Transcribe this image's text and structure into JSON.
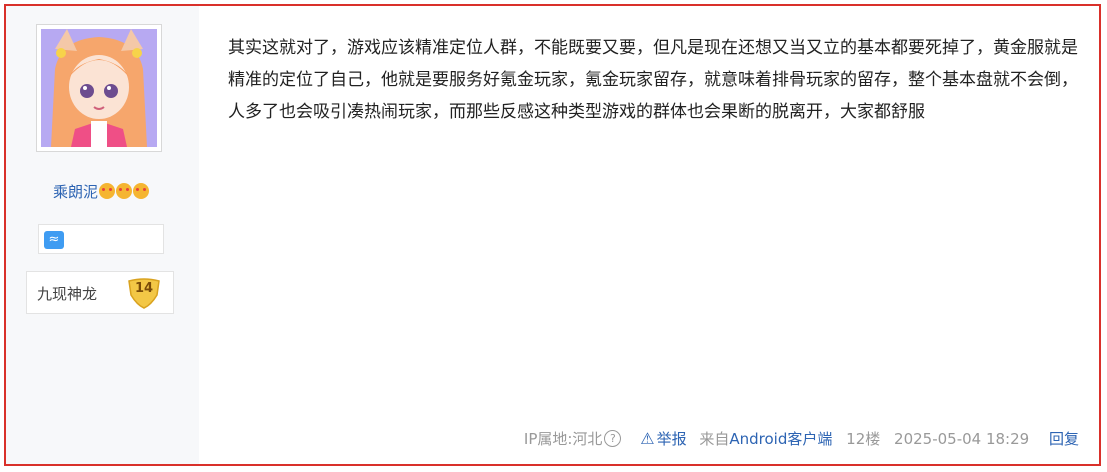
{
  "user": {
    "name": "乘朗泥",
    "name_emojis": [
      "heart-eyes-emoji",
      "kiss-emoji",
      "heart-eyes-emoji"
    ],
    "zodiac_icon": "aquarius-icon",
    "level_title": "九现神龙",
    "level_number": "14"
  },
  "post": {
    "content": "其实这就对了，游戏应该精准定位人群，不能既要又要，但凡是现在还想又当又立的基本都要死掉了，黄金服就是精准的定位了自己，他就是要服务好氪金玩家，氪金玩家留存，就意味着排骨玩家的留存，整个基本盘就不会倒，人多了也会吸引凑热闹玩家，而那些反感这种类型游戏的群体也会果断的脱离开，大家都舒服"
  },
  "footer": {
    "ip_location": "IP属地:河北",
    "report_label": "举报",
    "source_prefix": "来自",
    "source_client": "Android客户端",
    "floor": "12楼",
    "timestamp": "2025-05-04 18:29",
    "reply_label": "回复"
  },
  "colors": {
    "border": "#d9302a",
    "link": "#2d64b3",
    "sidebar_bg": "#f7f8fa"
  }
}
